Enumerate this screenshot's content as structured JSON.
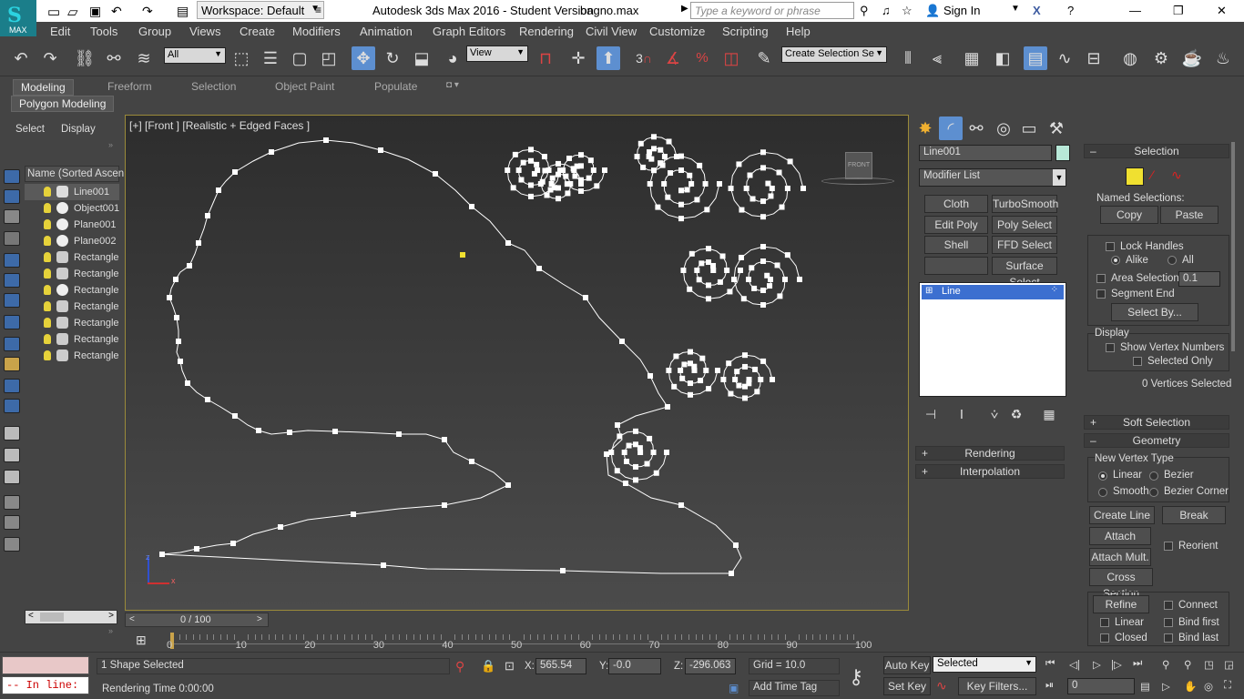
{
  "app": {
    "workspace": "Workspace: Default",
    "title": "Autodesk 3ds Max 2016 - Student Version",
    "filename": "bagno.max",
    "search_placeholder": "Type a keyword or phrase",
    "sign_in": "Sign In",
    "logo_text": "MAX"
  },
  "menu": [
    "Edit",
    "Tools",
    "Group",
    "Views",
    "Create",
    "Modifiers",
    "Animation",
    "Graph Editors",
    "Rendering",
    "Civil View",
    "Customize",
    "Scripting",
    "Help"
  ],
  "toolbar": {
    "filter_value": "All",
    "ref_coord": "View",
    "selection_set_placeholder": "Create Selection Se",
    "snap_label": "3"
  },
  "ribbon": {
    "tabs": [
      "Modeling",
      "Freeform",
      "Selection",
      "Object Paint",
      "Populate"
    ],
    "active_tab": "Modeling",
    "sub_tab": "Polygon Modeling"
  },
  "explorer": {
    "menu_select": "Select",
    "menu_display": "Display",
    "column_header": "Name (Sorted Ascen",
    "items": [
      "Line001",
      "Object001",
      "Plane001",
      "Plane002",
      "Rectangle",
      "Rectangle",
      "Rectangle",
      "Rectangle",
      "Rectangle",
      "Rectangle",
      "Rectangle"
    ]
  },
  "viewport": {
    "label": "[+] [Front ] [Realistic + Edged Faces ]",
    "viewcube_label": "FRONT",
    "axis_y": "z",
    "axis_x": "x"
  },
  "timeline": {
    "frame_display": "0 / 100",
    "ticks": [
      "0",
      "10",
      "20",
      "30",
      "40",
      "50",
      "60",
      "70",
      "80",
      "90",
      "100"
    ]
  },
  "command_panel": {
    "object_name": "Line001",
    "modifier_list": "Modifier List",
    "modifier_buttons": [
      "Cloth",
      "TurboSmooth",
      "Edit Poly",
      "Poly Select",
      "Shell",
      "FFD Select",
      "",
      "Surface Select"
    ],
    "stack_item": "Line",
    "rollups": [
      "Rendering",
      "Interpolation"
    ]
  },
  "selection_rollout": {
    "title": "Selection",
    "named_selections": "Named Selections:",
    "copy": "Copy",
    "paste": "Paste",
    "lock_handles": "Lock Handles",
    "alike": "Alike",
    "all": "All",
    "area_selection": "Area Selection:",
    "area_value": "0.1",
    "segment_end": "Segment End",
    "select_by": "Select By...",
    "display": "Display",
    "show_vertex_numbers": "Show Vertex Numbers",
    "selected_only": "Selected Only",
    "vertices_selected": "0 Vertices Selected"
  },
  "soft_selection": "Soft Selection",
  "geometry": {
    "title": "Geometry",
    "new_vertex_type": "New Vertex Type",
    "linear": "Linear",
    "bezier": "Bezier",
    "smooth": "Smooth",
    "bezier_corner": "Bezier Corner",
    "create_line": "Create Line",
    "break": "Break",
    "attach": "Attach",
    "attach_mult": "Attach Mult.",
    "reorient": "Reorient",
    "cross_section": "Cross Section",
    "refine": "Refine",
    "connect": "Connect",
    "linear2": "Linear",
    "bind_first": "Bind first",
    "closed": "Closed",
    "bind_last": "Bind last"
  },
  "status": {
    "in_line": "-- In line:",
    "shape_selected": "1 Shape Selected",
    "rendering_time": "Rendering Time  0:00:00",
    "x_label": "X:",
    "x_value": "565.54",
    "y_label": "Y:",
    "y_value": "-0.0",
    "z_label": "Z:",
    "z_value": "-296.063",
    "grid": "Grid = 10.0",
    "add_time_tag": "Add Time Tag",
    "auto_key": "Auto Key",
    "set_key": "Set Key",
    "selected_dropdown": "Selected",
    "key_filters": "Key Filters...",
    "frame_value": "0"
  },
  "colors": {
    "accent": "#5d8fd0",
    "viewport_border": "#9a8a3a",
    "object_color": "#b8e8d8",
    "vertex_selected": "#f0e030"
  }
}
